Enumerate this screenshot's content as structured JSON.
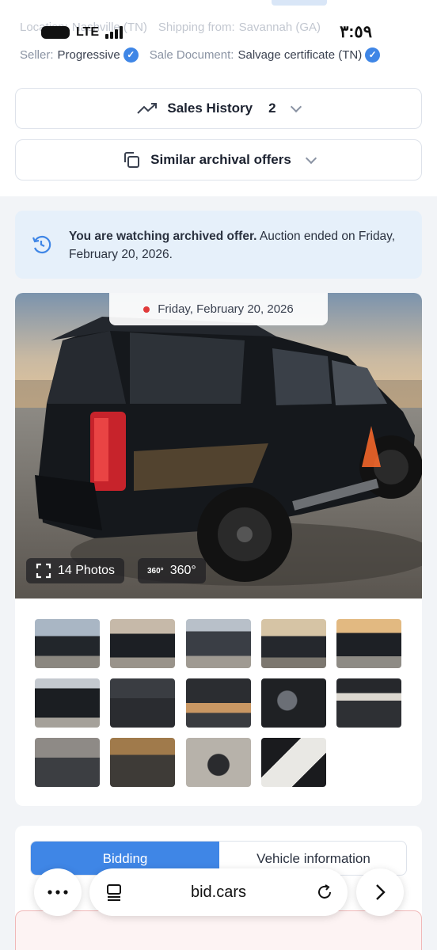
{
  "status_bar": {
    "network": "LTE",
    "time": "٣:٥٩"
  },
  "meta": {
    "location_label": "Location:",
    "location_value": "Nashville (TN)",
    "shipping_label": "Shipping from:",
    "shipping_value": "Savannah (GA)",
    "seller_label": "Seller:",
    "seller_value": "Progressive",
    "doc_label": "Sale Document:",
    "doc_value": "Salvage certificate (TN)"
  },
  "sales_history": {
    "label": "Sales History",
    "count": "2"
  },
  "similar_offers": {
    "label": "Similar archival offers"
  },
  "notice": {
    "bold": "You are watching archived offer.",
    "text": " Auction ended on Friday, February 20, 2026."
  },
  "gallery": {
    "date": "Friday, February 20, 2026",
    "photos_label": "14 Photos",
    "view360_label": "360°",
    "icon360_text": "360°"
  },
  "tabs": {
    "bidding": "Bidding",
    "vehicle_info": "Vehicle information"
  },
  "browser": {
    "url": "bid.cars"
  },
  "colors": {
    "accent": "#3f86e6",
    "notice_bg": "#e6f0fa",
    "verified": "#3f86e6"
  },
  "icons": [
    "trending-up-icon",
    "copy-icon",
    "history-icon",
    "fullscreen-icon",
    "360-icon",
    "more-icon",
    "tabs-icon",
    "reload-icon",
    "forward-icon"
  ]
}
